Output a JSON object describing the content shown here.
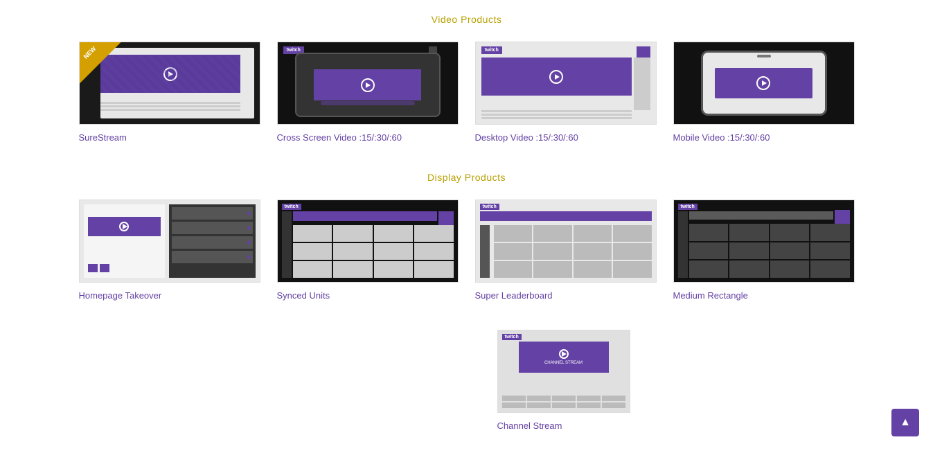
{
  "sections": {
    "video_products": {
      "title": "Video Products",
      "items": [
        {
          "id": "surestream",
          "label": "SureStream",
          "badge": "NEW"
        },
        {
          "id": "cross-screen-video",
          "label": "Cross Screen Video :15/:30/:60"
        },
        {
          "id": "desktop-video",
          "label": "Desktop Video :15/:30/:60"
        },
        {
          "id": "mobile-video",
          "label": "Mobile Video :15/:30/:60"
        }
      ]
    },
    "display_products": {
      "title": "Display Products",
      "items": [
        {
          "id": "homepage-takeover",
          "label": "Homepage Takeover"
        },
        {
          "id": "synced-units",
          "label": "Synced Units"
        },
        {
          "id": "super-leaderboard",
          "label": "Super Leaderboard"
        },
        {
          "id": "medium-rectangle",
          "label": "Medium Rectangle"
        }
      ]
    },
    "bottom_items": [
      {
        "id": "channel-stream",
        "label": "Channel Stream"
      }
    ]
  },
  "scroll_button": {
    "label": "▲"
  }
}
